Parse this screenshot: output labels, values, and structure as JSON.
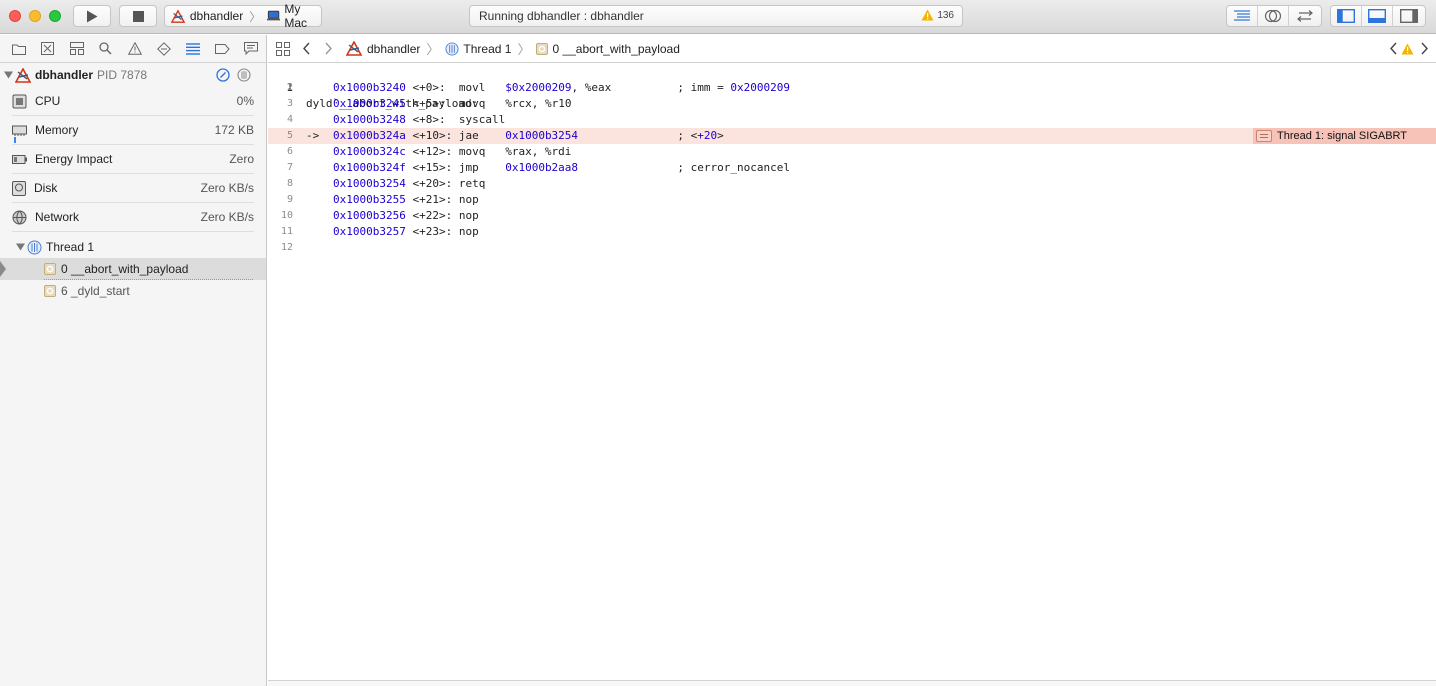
{
  "toolbar": {
    "scheme": {
      "target": "dbhandler",
      "destination": "My Mac"
    },
    "activity": {
      "status": "Running dbhandler : dbhandler",
      "warning_count": "136"
    }
  },
  "navigator": {
    "tabs": [
      "folder-icon",
      "source-control-icon",
      "symbol-icon",
      "search-icon",
      "warning-icon",
      "test-icon",
      "debug-icon",
      "breakpoint-icon",
      "report-icon"
    ],
    "process": {
      "name": "dbhandler",
      "pid": "PID 7878"
    },
    "gauges": [
      {
        "label": "CPU",
        "value": "0%"
      },
      {
        "label": "Memory",
        "value": "172 KB"
      },
      {
        "label": "Energy Impact",
        "value": "Zero"
      },
      {
        "label": "Disk",
        "value": "Zero KB/s"
      },
      {
        "label": "Network",
        "value": "Zero KB/s"
      }
    ],
    "thread": {
      "label": "Thread 1"
    },
    "frames": [
      {
        "label": "0 __abort_with_payload"
      },
      {
        "label": "6 _dyld_start"
      }
    ]
  },
  "jumpbar": {
    "project": "dbhandler",
    "thread": "Thread 1",
    "frame": "0 __abort_with_payload"
  },
  "code": {
    "header": "dyld`__abort_with_payload:",
    "lines": [
      {
        "num": "2",
        "arrow": "",
        "addr": "0x1000b3240",
        "off": " <+0>:",
        "rest1": "  movl   ",
        "lit": "$0x2000209",
        "rest2": ", %eax          ; imm = ",
        "lit2": "0x2000209"
      },
      {
        "num": "3",
        "arrow": "",
        "addr": "0x1000b3245",
        "off": " <+5>:",
        "rest1": "  movq   %rcx, %r10",
        "lit": "",
        "rest2": "",
        "lit2": ""
      },
      {
        "num": "4",
        "arrow": "",
        "addr": "0x1000b3248",
        "off": " <+8>:",
        "rest1": "  syscall",
        "lit": "",
        "rest2": "",
        "lit2": ""
      },
      {
        "num": "5",
        "arrow": "->",
        "addr": "0x1000b324a",
        "off": " <+10>:",
        "rest1": " jae    ",
        "lit": "0x1000b3254",
        "rest2": "               ; <",
        "lit2": "+20",
        "tail": ">"
      },
      {
        "num": "6",
        "arrow": "",
        "addr": "0x1000b324c",
        "off": " <+12>:",
        "rest1": " movq   %rax, %rdi",
        "lit": "",
        "rest2": "",
        "lit2": ""
      },
      {
        "num": "7",
        "arrow": "",
        "addr": "0x1000b324f",
        "off": " <+15>:",
        "rest1": " jmp    ",
        "lit": "0x1000b2aa8",
        "rest2": "               ; cerror_nocancel",
        "lit2": ""
      },
      {
        "num": "8",
        "arrow": "",
        "addr": "0x1000b3254",
        "off": " <+20>:",
        "rest1": " retq",
        "lit": "",
        "rest2": "",
        "lit2": ""
      },
      {
        "num": "9",
        "arrow": "",
        "addr": "0x1000b3255",
        "off": " <+21>:",
        "rest1": " nop",
        "lit": "",
        "rest2": "",
        "lit2": ""
      },
      {
        "num": "10",
        "arrow": "",
        "addr": "0x1000b3256",
        "off": " <+22>:",
        "rest1": " nop",
        "lit": "",
        "rest2": "",
        "lit2": ""
      },
      {
        "num": "11",
        "arrow": "",
        "addr": "0x1000b3257",
        "off": " <+23>:",
        "rest1": " nop",
        "lit": "",
        "rest2": "",
        "lit2": ""
      },
      {
        "num": "12",
        "arrow": "",
        "addr": "",
        "off": "",
        "rest1": "",
        "lit": "",
        "rest2": "",
        "lit2": ""
      }
    ],
    "annotation": "Thread 1: signal SIGABRT"
  },
  "colors": {
    "address": "#1c00cf",
    "highlight_line": "#fbe3de",
    "annotation": "#f7c2b7",
    "warning": "#f5b400"
  }
}
